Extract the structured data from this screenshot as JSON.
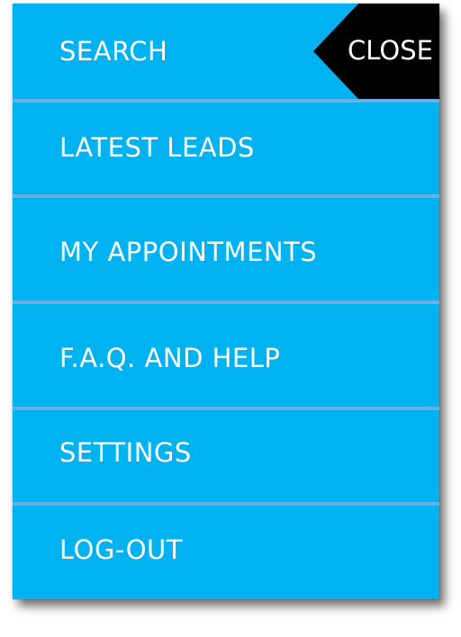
{
  "menu": {
    "items": [
      {
        "label": "SEARCH"
      },
      {
        "label": "LATEST LEADS"
      },
      {
        "label": "MY APPOINTMENTS"
      },
      {
        "label": "F.A.Q. AND HELP"
      },
      {
        "label": "SETTINGS"
      },
      {
        "label": "LOG-OUT"
      }
    ],
    "close_label": "CLOSE"
  },
  "colors": {
    "panel_background": "#00b2f0",
    "divider": "#6aaee6",
    "text": "#ffffff",
    "close_background": "#000000"
  }
}
